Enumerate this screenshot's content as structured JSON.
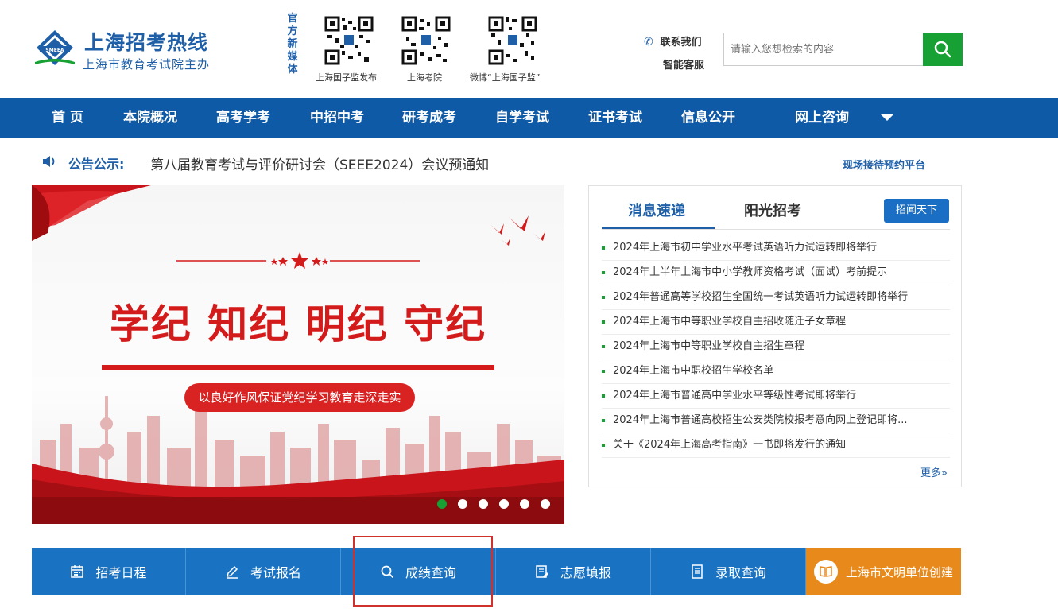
{
  "header": {
    "site_title": "上海招考热线",
    "site_subtitle": "上海市教育考试院主办",
    "media_label": "官方新媒体",
    "qr_captions": [
      "上海国子监发布",
      "上海考院",
      "微博“上海国子监”"
    ],
    "contact_label": "联系我们",
    "robot_label": "智能客服",
    "search_placeholder": "请输入您想检索的内容"
  },
  "nav": {
    "items": [
      "首  页",
      "本院概况",
      "高考学考",
      "中招中考",
      "研考成考",
      "自学考试",
      "证书考试",
      "信息公开",
      "网上咨询"
    ]
  },
  "notice": {
    "label": "公告公示:",
    "text": "第八届教育考试与评价研讨会（SEEE2024）会议预通知",
    "appointment_link": "现场接待预约平台"
  },
  "banner": {
    "headline": "学纪  知纪  明纪  守纪",
    "slogan": "以良好作风保证党纪学习教育走深走实",
    "slide_count": 6,
    "active_slide": 1
  },
  "news": {
    "tabs": [
      "消息速递",
      "阳光招考"
    ],
    "active_tab": 0,
    "button_label": "招闻天下",
    "items": [
      "2024年上海市初中学业水平考试英语听力试运转即将举行",
      "2024年上半年上海市中小学教师资格考试（面试）考前提示",
      "2024年普通高等学校招生全国统一考试英语听力试运转即将举行",
      "2024年上海市中等职业学校自主招收随迁子女章程",
      "2024年上海市中等职业学校自主招生章程",
      "2024年上海市中职校招生学校名单",
      "2024年上海市普通高中学业水平等级性考试即将举行",
      "2024年上海市普通高校招生公安类院校报考意向网上登记即将...",
      "关于《2024年上海高考指南》一书即将发行的通知"
    ],
    "more_label": "更多»"
  },
  "quick": {
    "items": [
      "招考日程",
      "考试报名",
      "成绩查询",
      "志愿填报",
      "录取查询",
      "上海市文明单位创建"
    ]
  },
  "colors": {
    "brand_blue": "#0f5aa6",
    "accent_green": "#17a033",
    "quick_blue": "#1a73c2",
    "quick_orange": "#e8891c",
    "banner_red": "#d41b1b",
    "highlight_red": "#d0312d"
  }
}
